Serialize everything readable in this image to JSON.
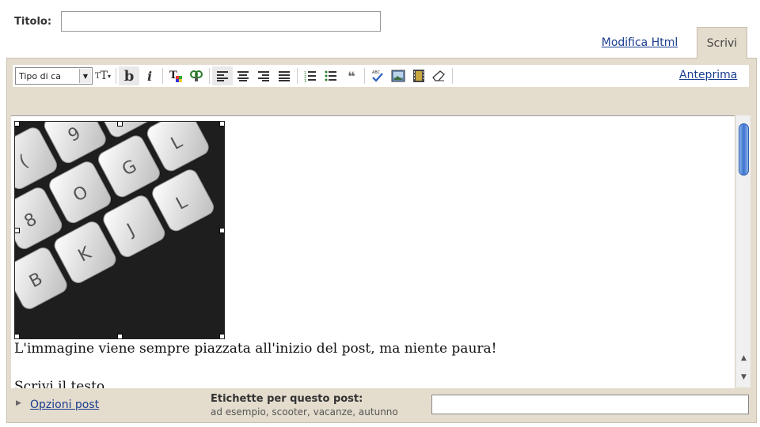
{
  "post": {
    "title_label": "Titolo:",
    "title_value": "",
    "body_line1": "L'immagine viene sempre piazzata all'inizio del post, ma niente paura!",
    "body_line2_partial": "Scrivi il testo ....."
  },
  "tabs": {
    "html_label": "Modifica Html",
    "compose_label": "Scrivi",
    "active": "Scrivi"
  },
  "toolbar": {
    "font_select_value": "Tipo di ca",
    "preview_label": "Anteprima",
    "icons": [
      "font-size-icon",
      "bold-icon",
      "italic-icon",
      "text-color-icon",
      "link-icon",
      "align-left-icon",
      "align-center-icon",
      "align-right-icon",
      "justify-icon",
      "numbered-list-icon",
      "bullet-list-icon",
      "blockquote-icon",
      "spellcheck-icon",
      "insert-image-icon",
      "insert-video-icon",
      "remove-formatting-icon"
    ]
  },
  "image": {
    "keys": [
      "(",
      "9",
      "0",
      "8",
      "O",
      "G",
      "L",
      "B",
      "K",
      "J",
      "L"
    ],
    "alt": "keyboard-photo"
  },
  "footer": {
    "options_label": "Opzioni post",
    "labels_title": "Etichette per questo post:",
    "labels_hint": "ad esempio, scooter, vacanze, autunno",
    "labels_value": ""
  },
  "colors": {
    "frame_bg": "#e4dccd",
    "link": "#1a3d8f",
    "scroll_thumb": "#3a73d1"
  }
}
